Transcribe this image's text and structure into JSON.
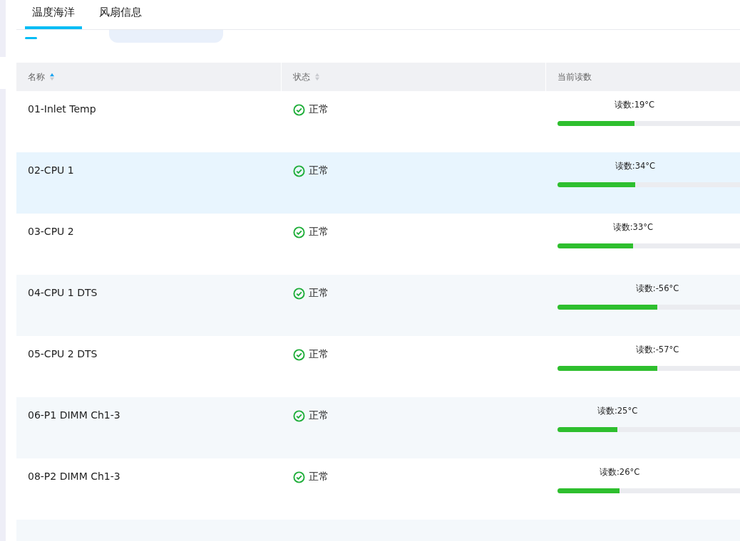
{
  "tabs": [
    {
      "label": "温度海洋",
      "selected": true
    },
    {
      "label": "风扇信息",
      "selected": false
    }
  ],
  "table": {
    "columns": [
      {
        "label": "名称",
        "sortable": true,
        "sorted": true
      },
      {
        "label": "状态",
        "sortable": true,
        "sorted": false
      },
      {
        "label": "当前读数"
      }
    ],
    "rows": [
      {
        "name": "01-Inlet Temp",
        "status": "正常",
        "reading": "读数:19°C",
        "level": 0.42,
        "highlighted": false
      },
      {
        "name": "02-CPU 1",
        "status": "正常",
        "reading": "读数:34°C",
        "level": 0.424,
        "highlighted": true
      },
      {
        "name": "03-CPU 2",
        "status": "正常",
        "reading": "读数:33°C",
        "level": 0.412,
        "highlighted": false
      },
      {
        "name": "04-CPU 1 DTS",
        "status": "正常",
        "reading": "读数:-56°C",
        "level": 0.545,
        "highlighted": false
      },
      {
        "name": "05-CPU 2 DTS",
        "status": "正常",
        "reading": "读数:-57°C",
        "level": 0.545,
        "highlighted": false
      },
      {
        "name": "06-P1 DIMM Ch1-3",
        "status": "正常",
        "reading": "读数:25°C",
        "level": 0.327,
        "highlighted": false
      },
      {
        "name": "08-P2 DIMM Ch1-3",
        "status": "正常",
        "reading": "读数:26°C",
        "level": 0.339,
        "highlighted": false
      }
    ]
  }
}
